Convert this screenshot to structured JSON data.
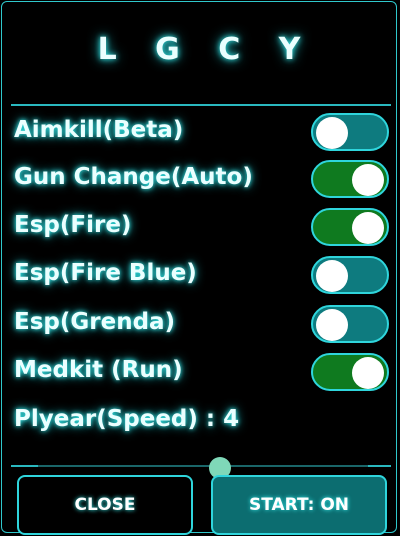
{
  "panel": {
    "title": "L G C Y"
  },
  "toggles": [
    {
      "label": "Aimkill(Beta)",
      "state": "off"
    },
    {
      "label": "Gun Change(Auto)",
      "state": "on"
    },
    {
      "label": "Esp(Fire)",
      "state": "on"
    },
    {
      "label": "Esp(Fire Blue)",
      "state": "off"
    },
    {
      "label": "Esp(Grenda)",
      "state": "off"
    },
    {
      "label": "Medkit (Run)",
      "state": "on"
    }
  ],
  "speed": {
    "label": "Plyear(Speed) : 4",
    "value": 4,
    "level_fraction": 0.52
  },
  "buttons": {
    "close": "CLOSE",
    "start": "START: ON"
  },
  "colors": {
    "accent": "#2fd5dc",
    "toggle_on": "#0f7a1f",
    "toggle_off": "#0e7b7f",
    "start_bg": "#0c6d70"
  }
}
